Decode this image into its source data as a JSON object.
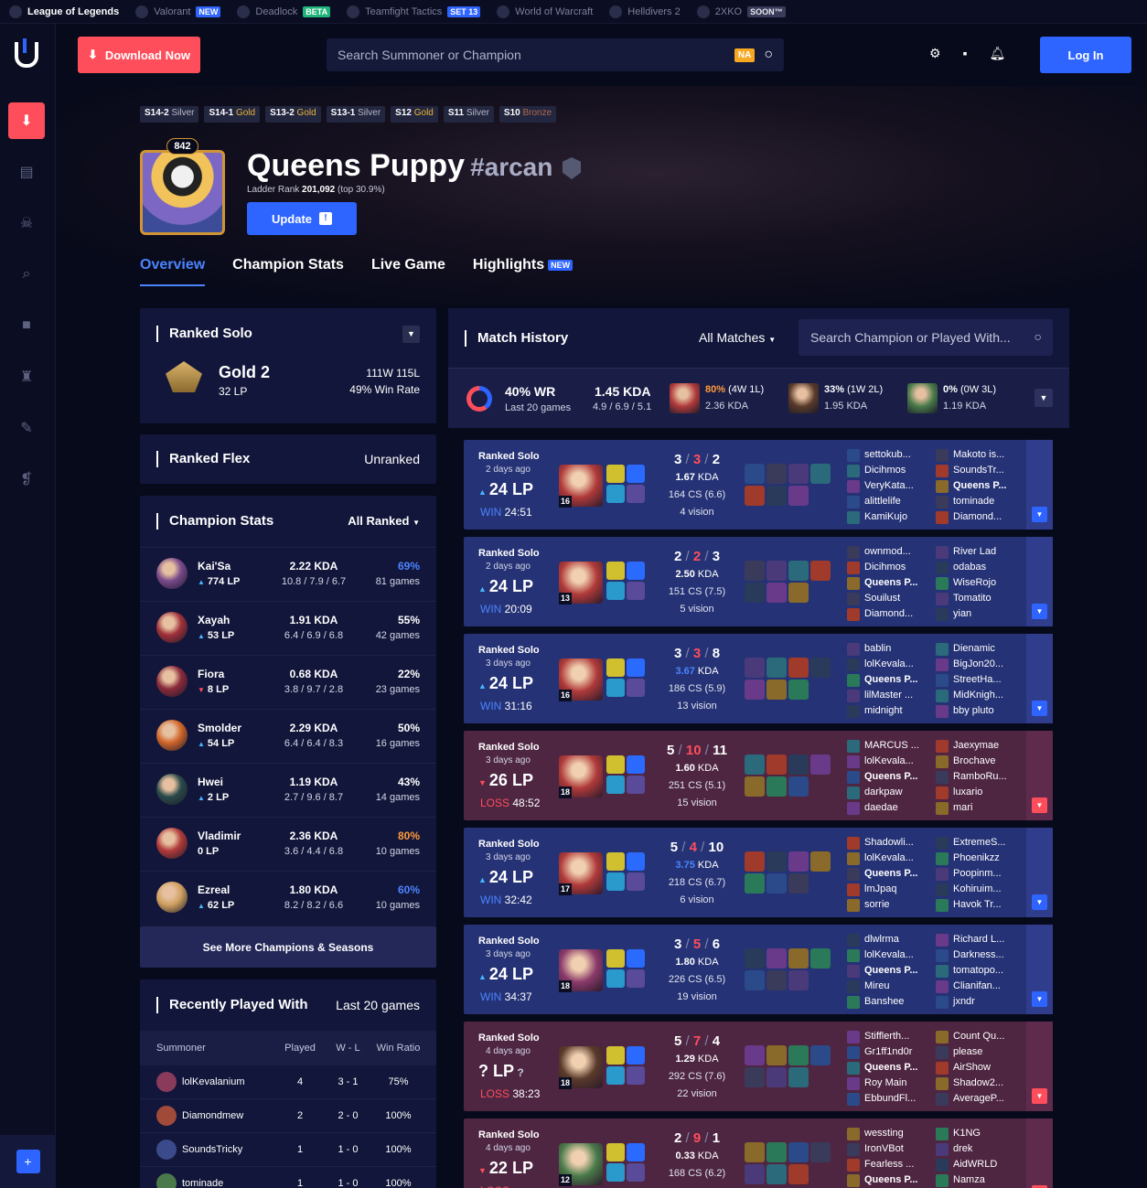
{
  "topbar": {
    "items": [
      {
        "label": "League of Legends",
        "tag": ""
      },
      {
        "label": "Valorant",
        "tag": "NEW"
      },
      {
        "label": "Deadlock",
        "tag": "BETA"
      },
      {
        "label": "Teamfight Tactics",
        "tag": "SET 13"
      },
      {
        "label": "World of Warcraft",
        "tag": ""
      },
      {
        "label": "Helldivers 2",
        "tag": ""
      },
      {
        "label": "2XKO",
        "tag": "SOON™"
      }
    ]
  },
  "header": {
    "download_label": "Download Now",
    "search_placeholder": "Search Summoner or Champion",
    "region": "NA",
    "login_label": "Log In"
  },
  "seasons": [
    {
      "season": "S14-2",
      "tier": "Silver",
      "color": "#b8b8c8"
    },
    {
      "season": "S14-1",
      "tier": "Gold",
      "color": "#e8b63a"
    },
    {
      "season": "S13-2",
      "tier": "Gold",
      "color": "#e8b63a"
    },
    {
      "season": "S13-1",
      "tier": "Silver",
      "color": "#b8b8c8"
    },
    {
      "season": "S12",
      "tier": "Gold",
      "color": "#e8b63a"
    },
    {
      "season": "S11",
      "tier": "Silver",
      "color": "#b8b8c8"
    },
    {
      "season": "S10",
      "tier": "Bronze",
      "color": "#b06a4a"
    }
  ],
  "profile": {
    "level": "842",
    "name": "Queens Puppy",
    "tag": "#arcan",
    "ladder_label": "Ladder Rank",
    "ladder_rank": "201,092",
    "ladder_top": "(top 30.9%)",
    "update_label": "Update",
    "update_bang": "!"
  },
  "tabs": [
    {
      "label": "Overview",
      "badge": ""
    },
    {
      "label": "Champion Stats",
      "badge": ""
    },
    {
      "label": "Live Game",
      "badge": ""
    },
    {
      "label": "Highlights",
      "badge": "NEW"
    }
  ],
  "ranked_solo": {
    "title": "Ranked Solo",
    "rank": "Gold 2",
    "lp": "32 LP",
    "record": "111W 115L",
    "winrate": "49% Win Rate"
  },
  "ranked_flex": {
    "title": "Ranked Flex",
    "status": "Unranked"
  },
  "champion_stats": {
    "title": "Champion Stats",
    "filter": "All Ranked",
    "see_more": "See More Champions & Seasons",
    "rows": [
      {
        "name": "Kai'Sa",
        "lp": "774 LP",
        "dir": "up",
        "kda": "2.22 KDA",
        "kdas": "10.8 / 7.9 / 6.7",
        "wr": "69%",
        "wr_color": "#4b84ff",
        "games": "81 games",
        "color": "#7a4a8a"
      },
      {
        "name": "Xayah",
        "lp": "53 LP",
        "dir": "up",
        "kda": "1.91 KDA",
        "kdas": "6.4 / 6.9 / 6.8",
        "wr": "55%",
        "wr_color": "#ffffff",
        "games": "42 games",
        "color": "#a0303a"
      },
      {
        "name": "Fiora",
        "lp": "8 LP",
        "dir": "down",
        "kda": "0.68 KDA",
        "kdas": "3.8 / 9.7 / 2.8",
        "wr": "22%",
        "wr_color": "#ffffff",
        "games": "23 games",
        "color": "#8a2a3a"
      },
      {
        "name": "Smolder",
        "lp": "54 LP",
        "dir": "up",
        "kda": "2.29 KDA",
        "kdas": "6.4 / 6.4 / 8.3",
        "wr": "50%",
        "wr_color": "#ffffff",
        "games": "16 games",
        "color": "#d0662a"
      },
      {
        "name": "Hwei",
        "lp": "2 LP",
        "dir": "up",
        "kda": "1.19 KDA",
        "kdas": "2.7 / 9.6 / 8.7",
        "wr": "43%",
        "wr_color": "#ffffff",
        "games": "14 games",
        "color": "#2a4a4a"
      },
      {
        "name": "Vladimir",
        "lp": "0 LP",
        "dir": "",
        "kda": "2.36 KDA",
        "kdas": "3.6 / 4.4 / 6.8",
        "wr": "80%",
        "wr_color": "#ff9b3a",
        "games": "10 games",
        "color": "#b03a3a"
      },
      {
        "name": "Ezreal",
        "lp": "62 LP",
        "dir": "up",
        "kda": "1.80 KDA",
        "kdas": "8.2 / 8.2 / 6.6",
        "wr": "60%",
        "wr_color": "#4b84ff",
        "games": "10 games",
        "color": "#d0a060"
      }
    ]
  },
  "recently_played": {
    "title": "Recently Played With",
    "subtitle": "Last 20 games",
    "headers": [
      "Summoner",
      "Played",
      "W - L",
      "Win Ratio"
    ],
    "rows": [
      {
        "name": "lolKevalanium",
        "played": "4",
        "wl": "3 - 1",
        "ratio": "75%",
        "color": "#8a3a5a"
      },
      {
        "name": "Diamondmew",
        "played": "2",
        "wl": "2 - 0",
        "ratio": "100%",
        "color": "#a04a3a"
      },
      {
        "name": "SoundsTricky",
        "played": "1",
        "wl": "1 - 0",
        "ratio": "100%",
        "color": "#3a4a8a"
      },
      {
        "name": "tominade",
        "played": "1",
        "wl": "1 - 0",
        "ratio": "100%",
        "color": "#4a7a4a"
      }
    ]
  },
  "match_history": {
    "title": "Match History",
    "filter": "All Matches",
    "search_placeholder": "Search Champion or Played With...",
    "summary": {
      "winrate": 40,
      "wr_label": "40% WR",
      "games_label": "Last 20 games",
      "kda_label": "1.45 KDA",
      "kda_split": "4.9 / 6.9 / 5.1",
      "champs": [
        {
          "wr": "80%",
          "rec": "(4W 1L)",
          "kda": "2.36 KDA",
          "wr_color": "#ff9b3a",
          "color": "#b03a3a"
        },
        {
          "wr": "33%",
          "rec": "(1W 2L)",
          "kda": "1.95 KDA",
          "wr_color": "#ffffff",
          "color": "#5a3a2a"
        },
        {
          "wr": "0%",
          "rec": "(0W 3L)",
          "kda": "1.19 KDA",
          "wr_color": "#ffffff",
          "color": "#4a7a4a"
        }
      ]
    },
    "matches": [
      {
        "result": "win",
        "mode": "Ranked Solo",
        "ago": "2 days ago",
        "lp": "24 LP",
        "lp_dir": "up",
        "res_label": "WIN",
        "duration": "24:51",
        "level": "16",
        "k": "3",
        "d": "3",
        "a": "2",
        "ratio": "1.67",
        "ratio_color": "#ffffff",
        "cs": "164 CS (6.6)",
        "vision": "4 vision",
        "champ_color": "#b03a3a",
        "team1": [
          "settokub...",
          "Dicihmos",
          "VeryKata...",
          "alittlelife",
          "KamiKujo"
        ],
        "team2": [
          "Makoto is...",
          "SoundsTr...",
          "Queens P...",
          "tominade",
          "Diamond..."
        ],
        "me_team": 2,
        "me_idx": 2
      },
      {
        "result": "win",
        "mode": "Ranked Solo",
        "ago": "2 days ago",
        "lp": "24 LP",
        "lp_dir": "up",
        "res_label": "WIN",
        "duration": "20:09",
        "level": "13",
        "k": "2",
        "d": "2",
        "a": "3",
        "ratio": "2.50",
        "ratio_color": "#ffffff",
        "cs": "151 CS (7.5)",
        "vision": "5 vision",
        "champ_color": "#b03a3a",
        "team1": [
          "ownmod...",
          "Dicihmos",
          "Queens P...",
          "Souilust",
          "Diamond..."
        ],
        "team2": [
          "River Lad",
          "odabas",
          "WiseRojo",
          "Tomatito",
          "yian"
        ],
        "me_team": 1,
        "me_idx": 2
      },
      {
        "result": "win",
        "mode": "Ranked Solo",
        "ago": "3 days ago",
        "lp": "24 LP",
        "lp_dir": "up",
        "res_label": "WIN",
        "duration": "31:16",
        "level": "16",
        "k": "3",
        "d": "3",
        "a": "8",
        "ratio": "3.67",
        "ratio_color": "#4b84ff",
        "cs": "186 CS (5.9)",
        "vision": "13 vision",
        "champ_color": "#b03a3a",
        "team1": [
          "bablin",
          "lolKevala...",
          "Queens P...",
          "lilMaster ...",
          "midnight"
        ],
        "team2": [
          "Dienamic",
          "BigJon20...",
          "StreetHa...",
          "MidKnigh...",
          "bby pluto"
        ],
        "me_team": 1,
        "me_idx": 2
      },
      {
        "result": "loss",
        "mode": "Ranked Solo",
        "ago": "3 days ago",
        "lp": "26 LP",
        "lp_dir": "down",
        "res_label": "LOSS",
        "duration": "48:52",
        "level": "18",
        "k": "5",
        "d": "10",
        "a": "11",
        "ratio": "1.60",
        "ratio_color": "#ffffff",
        "cs": "251 CS (5.1)",
        "vision": "15 vision",
        "champ_color": "#b03a3a",
        "team1": [
          "MARCUS ...",
          "lolKevala...",
          "Queens P...",
          "darkpaw",
          "daedae"
        ],
        "team2": [
          "Jaexymae",
          "Brochave",
          "RamboRu...",
          "luxario",
          "mari"
        ],
        "me_team": 1,
        "me_idx": 2
      },
      {
        "result": "win",
        "mode": "Ranked Solo",
        "ago": "3 days ago",
        "lp": "24 LP",
        "lp_dir": "up",
        "res_label": "WIN",
        "duration": "32:42",
        "level": "17",
        "k": "5",
        "d": "4",
        "a": "10",
        "ratio": "3.75",
        "ratio_color": "#4b84ff",
        "cs": "218 CS (6.7)",
        "vision": "6 vision",
        "champ_color": "#b03a3a",
        "team1": [
          "Shadowli...",
          "lolKevala...",
          "Queens P...",
          "lmJpaq",
          "sorrie"
        ],
        "team2": [
          "ExtremeS...",
          "Phoenikzz",
          "Poopinm...",
          "Kohiruim...",
          "Havok Tr..."
        ],
        "me_team": 1,
        "me_idx": 2
      },
      {
        "result": "win",
        "mode": "Ranked Solo",
        "ago": "3 days ago",
        "lp": "24 LP",
        "lp_dir": "up",
        "res_label": "WIN",
        "duration": "34:37",
        "level": "18",
        "k": "3",
        "d": "5",
        "a": "6",
        "ratio": "1.80",
        "ratio_color": "#ffffff",
        "cs": "226 CS (6.5)",
        "vision": "19 vision",
        "champ_color": "#8a3a6a",
        "team1": [
          "dlwlrma",
          "lolKevala...",
          "Queens P...",
          "Mireu",
          "Banshee"
        ],
        "team2": [
          "Richard L...",
          "Darkness...",
          "tomatopo...",
          "Clianifan...",
          "jxndr"
        ],
        "me_team": 1,
        "me_idx": 2
      },
      {
        "result": "loss",
        "mode": "Ranked Solo",
        "ago": "4 days ago",
        "lp": "? LP",
        "lp_dir": "",
        "res_label": "LOSS",
        "duration": "38:23",
        "level": "18",
        "k": "5",
        "d": "7",
        "a": "4",
        "ratio": "1.29",
        "ratio_color": "#ffffff",
        "cs": "292 CS (7.6)",
        "vision": "22 vision",
        "champ_color": "#5a3a2a",
        "team1": [
          "Stifflerth...",
          "Gr1ff1nd0r",
          "Queens P...",
          "Roy Main",
          "EbbundFl..."
        ],
        "team2": [
          "Count Qu...",
          "please",
          "AirShow",
          "Shadow2...",
          "AverageP..."
        ],
        "me_team": 1,
        "me_idx": 2
      },
      {
        "result": "loss",
        "mode": "Ranked Solo",
        "ago": "4 days ago",
        "lp": "22 LP",
        "lp_dir": "down",
        "res_label": "LOSS",
        "duration": "",
        "level": "12",
        "k": "2",
        "d": "9",
        "a": "1",
        "ratio": "0.33",
        "ratio_color": "#ffffff",
        "cs": "168 CS (6.2)",
        "vision": "",
        "champ_color": "#4a7a4a",
        "team1": [
          "wessting",
          "IronVBot",
          "Fearless ...",
          "Queens P..."
        ],
        "team2": [
          "K1NG",
          "drek",
          "AidWRLD",
          "Namza"
        ],
        "me_team": 1,
        "me_idx": 3
      }
    ]
  }
}
